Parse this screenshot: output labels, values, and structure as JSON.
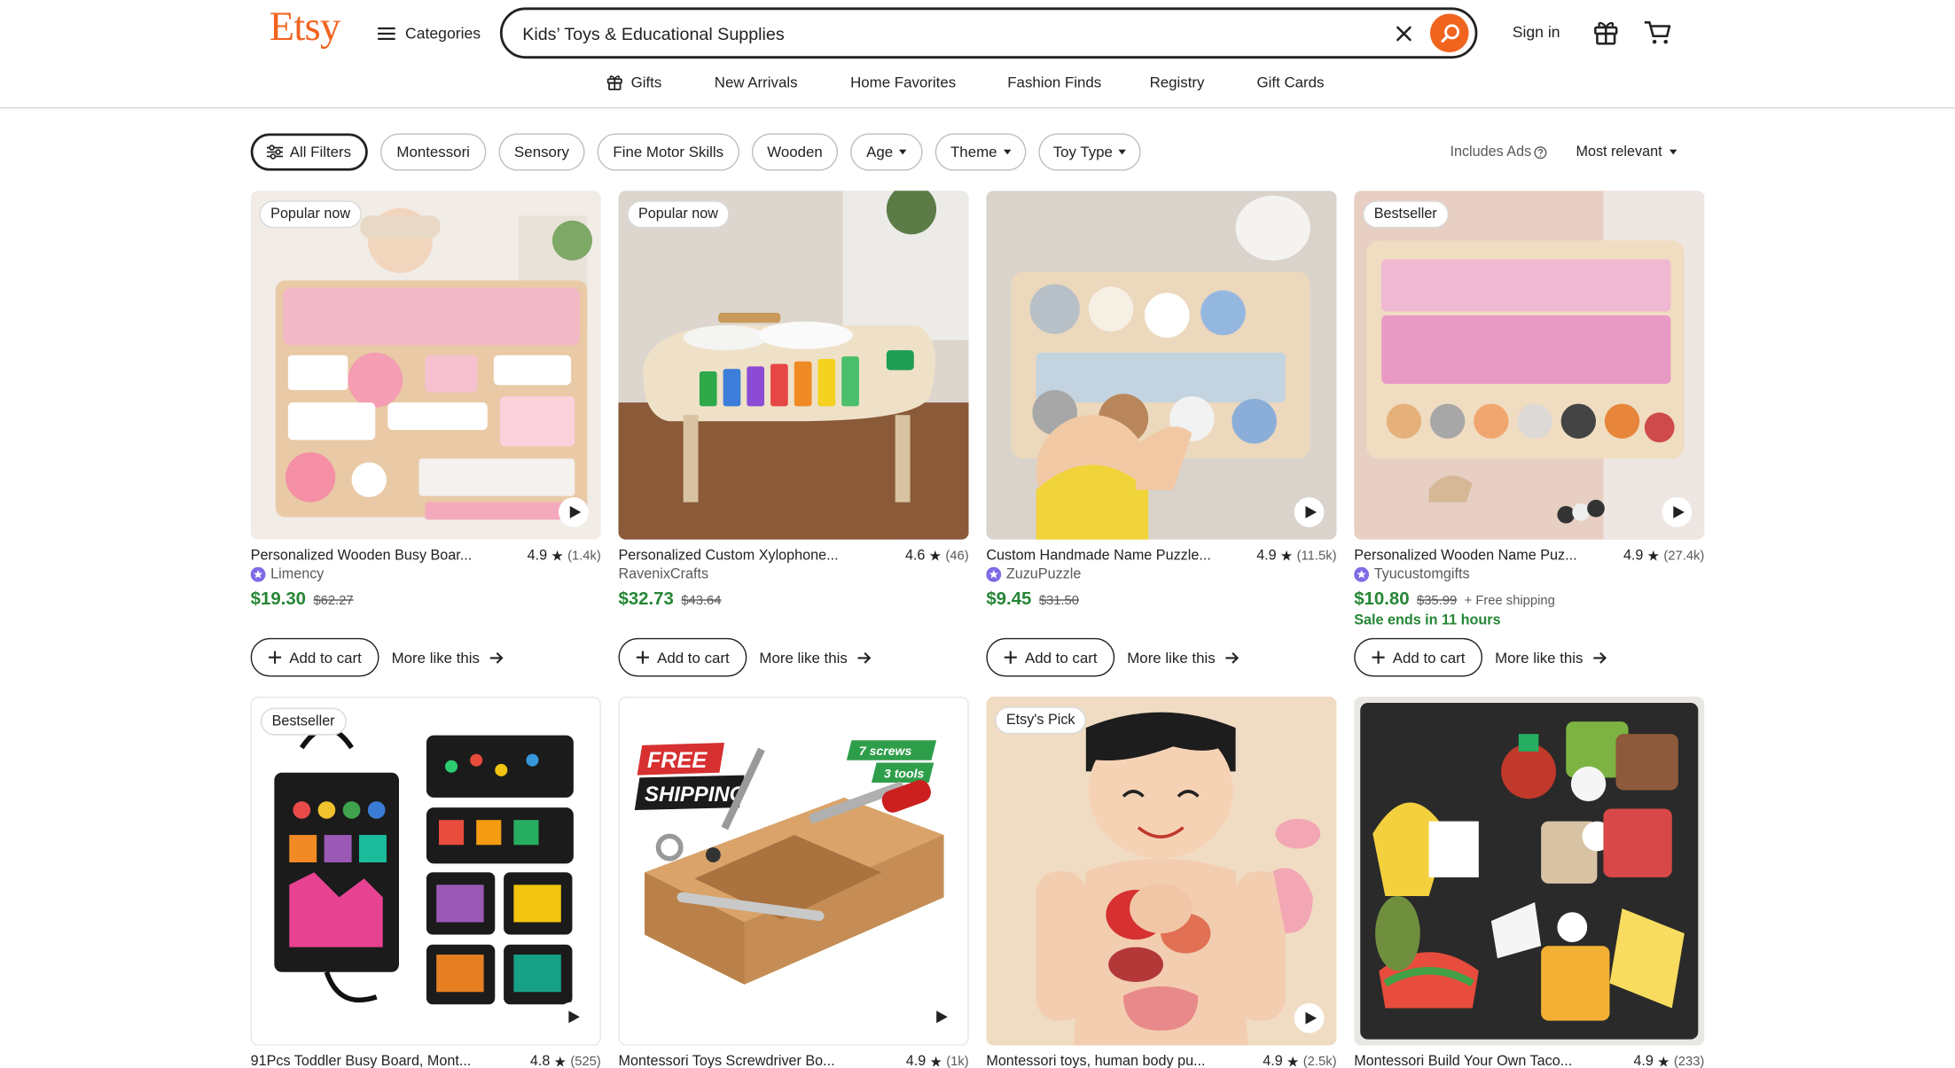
{
  "header": {
    "logo": "Etsy",
    "categories_label": "Categories",
    "search_value": "Kids’ Toys & Educational Supplies",
    "sign_in": "Sign in",
    "accent_color": "#f1641e"
  },
  "subnav": [
    {
      "label": "Gifts",
      "icon": "gift-icon"
    },
    {
      "label": "New Arrivals"
    },
    {
      "label": "Home Favorites"
    },
    {
      "label": "Fashion Finds"
    },
    {
      "label": "Registry"
    },
    {
      "label": "Gift Cards"
    }
  ],
  "filters": {
    "all_filters": "All Filters",
    "chips": [
      "Montessori",
      "Sensory",
      "Fine Motor Skills",
      "Wooden"
    ],
    "dropdowns": [
      "Age",
      "Theme",
      "Toy Type"
    ],
    "includes_ads": "Includes Ads",
    "sort": "Most relevant"
  },
  "listings": [
    {
      "badge": "Popular now",
      "title": "Personalized Wooden Busy Boar...",
      "rating": "4.9",
      "reviews": "(1.4k)",
      "shop": "Limency",
      "star_seller": true,
      "price": "$19.30",
      "original_price": "$62.27",
      "add_to_cart": "Add to cart",
      "more_like_this": "More like this",
      "video": true
    },
    {
      "badge": "Popular now",
      "title": "Personalized Custom Xylophone...",
      "rating": "4.6",
      "reviews": "(46)",
      "shop": "RavenixCrafts",
      "star_seller": false,
      "price": "$32.73",
      "original_price": "$43.64",
      "add_to_cart": "Add to cart",
      "more_like_this": "More like this",
      "video": false
    },
    {
      "title": "Custom Handmade Name Puzzle...",
      "rating": "4.9",
      "reviews": "(11.5k)",
      "shop": "ZuzuPuzzle",
      "star_seller": true,
      "price": "$9.45",
      "original_price": "$31.50",
      "add_to_cart": "Add to cart",
      "more_like_this": "More like this",
      "video": true
    },
    {
      "badge": "Bestseller",
      "title": "Personalized Wooden Name Puz...",
      "rating": "4.9",
      "reviews": "(27.4k)",
      "shop": "Tyucustomgifts",
      "star_seller": true,
      "price": "$10.80",
      "original_price": "$35.99",
      "shipping": "+ Free shipping",
      "sale_text": "Sale ends in 11 hours",
      "add_to_cart": "Add to cart",
      "more_like_this": "More like this",
      "video": true
    },
    {
      "badge": "Bestseller",
      "title": "91Pcs Toddler Busy Board, Mont...",
      "rating": "4.8",
      "reviews": "(525)",
      "video": true
    },
    {
      "title": "Montessori Toys Screwdriver Bo...",
      "rating": "4.9",
      "reviews": "(1k)",
      "video": true,
      "image_text": [
        "FREE",
        "SHIPPING",
        "7 screws",
        "3 tools"
      ]
    },
    {
      "badge": "Etsy's Pick",
      "title": "Montessori toys, human body pu...",
      "rating": "4.9",
      "reviews": "(2.5k)",
      "video": true
    },
    {
      "title": "Montessori Build Your Own Taco...",
      "rating": "4.9",
      "reviews": "(233)",
      "video": false
    }
  ]
}
